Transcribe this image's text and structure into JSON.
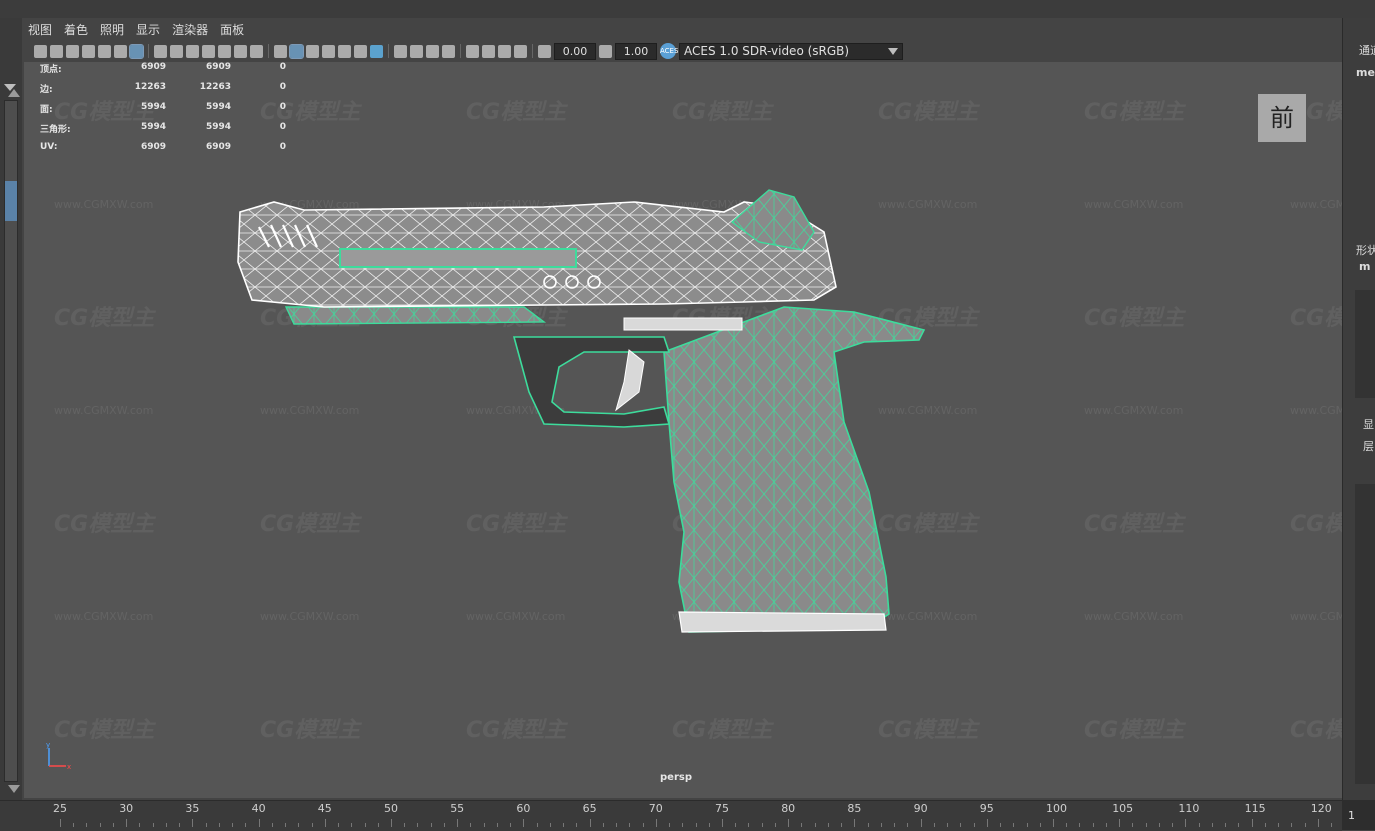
{
  "menu": [
    "视图",
    "着色",
    "照明",
    "显示",
    "渲染器",
    "面板"
  ],
  "toolbar": {
    "exposure": "0.00",
    "gamma": "1.00",
    "aces_icon": "ACES",
    "color_transform": "ACES 1.0 SDR-video (sRGB)"
  },
  "hud": [
    {
      "label": "顶点:",
      "v1": "6909",
      "v2": "6909",
      "v3": "0"
    },
    {
      "label": "边:",
      "v1": "12263",
      "v2": "12263",
      "v3": "0"
    },
    {
      "label": "面:",
      "v1": "5994",
      "v2": "5994",
      "v3": "0"
    },
    {
      "label": "三角形:",
      "v1": "5994",
      "v2": "5994",
      "v3": "0"
    },
    {
      "label": "UV:",
      "v1": "6909",
      "v2": "6909",
      "v3": "0"
    }
  ],
  "viewport": {
    "view_cube_label": "前",
    "camera": "persp",
    "axis_y": "y",
    "axis_x": "x"
  },
  "watermark": {
    "logo": "CG模型主",
    "url": "www.CGMXW.com"
  },
  "right_panel": {
    "tab1": "通道",
    "mesh1": "mes",
    "shape": "形状",
    "mesh2": "m",
    "display": "显",
    "layer": "层"
  },
  "timeline": {
    "ticks": [
      "25",
      "30",
      "35",
      "40",
      "45",
      "50",
      "55",
      "60",
      "65",
      "70",
      "75",
      "80",
      "85",
      "90",
      "95",
      "100",
      "105",
      "110",
      "115",
      "120"
    ],
    "current_frame": "1"
  },
  "colors": {
    "wire_selected": "#3ddc9c",
    "wire_default": "#ffffff",
    "viewport_bg": "#555555"
  }
}
